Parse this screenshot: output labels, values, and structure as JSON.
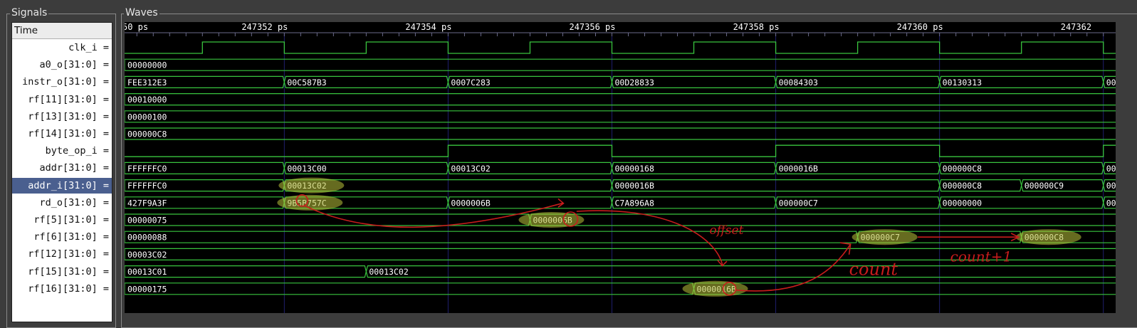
{
  "panels": {
    "signals_title": "Signals",
    "waves_title": "Waves"
  },
  "time_header": "Time",
  "timeline": {
    "start_ps": 247350.05,
    "end_ps": 247362.15,
    "tick_labels": [
      "50 ps",
      "247352 ps",
      "247354 ps",
      "247356 ps",
      "247358 ps",
      "247360 ps",
      "247362"
    ],
    "tick_values": [
      247350,
      247352,
      247354,
      247356,
      247358,
      247360,
      247362
    ]
  },
  "signals": [
    {
      "name": "clk_i =",
      "type": "bit",
      "transitions": [
        [
          247350,
          0
        ],
        [
          247351,
          1
        ],
        [
          247352,
          0
        ],
        [
          247353,
          1
        ],
        [
          247354,
          0
        ],
        [
          247355,
          1
        ],
        [
          247356,
          0
        ],
        [
          247357,
          1
        ],
        [
          247358,
          0
        ],
        [
          247359,
          1
        ],
        [
          247360,
          0
        ],
        [
          247361,
          1
        ],
        [
          247362,
          0
        ]
      ]
    },
    {
      "name": "a0_o[31:0] =",
      "type": "bus",
      "segments": [
        [
          247350,
          "00000000"
        ]
      ]
    },
    {
      "name": "instr_o[31:0] =",
      "type": "bus",
      "segments": [
        [
          247350,
          "FEE312E3"
        ],
        [
          247352,
          "00C587B3"
        ],
        [
          247354,
          "0007C283"
        ],
        [
          247356,
          "00D28833"
        ],
        [
          247358,
          "00084303"
        ],
        [
          247360,
          "00130313"
        ],
        [
          247362,
          "00"
        ]
      ]
    },
    {
      "name": "rf[11][31:0] =",
      "type": "bus",
      "segments": [
        [
          247350,
          "00010000"
        ]
      ]
    },
    {
      "name": "rf[13][31:0] =",
      "type": "bus",
      "segments": [
        [
          247350,
          "00000100"
        ]
      ]
    },
    {
      "name": "rf[14][31:0] =",
      "type": "bus",
      "segments": [
        [
          247350,
          "000000C8"
        ]
      ]
    },
    {
      "name": "byte_op_i =",
      "type": "bit",
      "transitions": [
        [
          247350,
          0
        ],
        [
          247354,
          1
        ],
        [
          247356,
          0
        ],
        [
          247358,
          1
        ],
        [
          247360,
          0
        ],
        [
          247362,
          1
        ]
      ]
    },
    {
      "name": "addr[31:0] =",
      "type": "bus",
      "segments": [
        [
          247350,
          "FFFFFFC0"
        ],
        [
          247352,
          "00013C00"
        ],
        [
          247354,
          "00013C02"
        ],
        [
          247356,
          "00000168"
        ],
        [
          247358,
          "0000016B"
        ],
        [
          247360,
          "000000C8"
        ],
        [
          247362,
          "00"
        ]
      ]
    },
    {
      "name": "addr_i[31:0] =",
      "type": "bus",
      "selected": true,
      "segments": [
        [
          247350,
          "FFFFFFC0"
        ],
        [
          247352,
          "00013C02"
        ],
        [
          247356,
          "0000016B"
        ],
        [
          247360,
          "000000C8"
        ],
        [
          247361,
          "000000C9"
        ],
        [
          247362,
          "00"
        ]
      ]
    },
    {
      "name": "rd_o[31:0] =",
      "type": "bus",
      "segments": [
        [
          247350,
          "427F9A3F"
        ],
        [
          247352,
          "9B5B757C"
        ],
        [
          247354,
          "0000006B"
        ],
        [
          247356,
          "C7A896A8"
        ],
        [
          247358,
          "000000C7"
        ],
        [
          247360,
          "00000000"
        ],
        [
          247362,
          "00"
        ]
      ]
    },
    {
      "name": "rf[5][31:0] =",
      "type": "bus",
      "segments": [
        [
          247350,
          "00000075"
        ],
        [
          247355,
          "0000006B"
        ]
      ]
    },
    {
      "name": "rf[6][31:0] =",
      "type": "bus",
      "segments": [
        [
          247350,
          "00000088"
        ],
        [
          247359,
          "000000C7"
        ],
        [
          247361,
          "000000C8"
        ]
      ]
    },
    {
      "name": "rf[12][31:0] =",
      "type": "bus",
      "segments": [
        [
          247350,
          "00003C02"
        ]
      ]
    },
    {
      "name": "rf[15][31:0] =",
      "type": "bus",
      "segments": [
        [
          247350,
          "00013C01"
        ],
        [
          247353,
          "00013C02"
        ]
      ]
    },
    {
      "name": "rf[16][31:0] =",
      "type": "bus",
      "segments": [
        [
          247350,
          "00000175"
        ],
        [
          247357,
          "0000016B"
        ]
      ]
    }
  ],
  "highlights": [
    {
      "row": 8,
      "label": "00013C02"
    },
    {
      "row": 9,
      "label": "9B5B757C"
    },
    {
      "row": 10,
      "label": "0000006B"
    },
    {
      "row": 11,
      "label": "000000C7"
    },
    {
      "row": 11,
      "label": "000000C8"
    },
    {
      "row": 14,
      "label": "0000016B"
    }
  ],
  "annotations": {
    "offset": "offset",
    "count": "count",
    "count_plus_one": "count+1"
  },
  "colors": {
    "wave": "#39c43e",
    "text": "#ffffff",
    "grid": "#1f1f6e",
    "highlight": "#b9c23a",
    "ink": "#c81c1c",
    "selected": "#4a5f8f"
  }
}
